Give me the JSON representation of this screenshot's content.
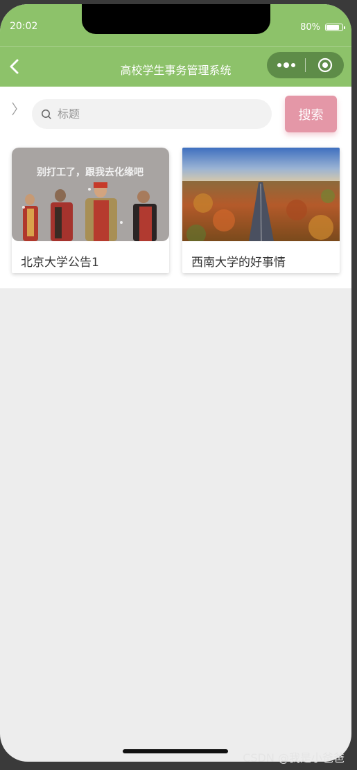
{
  "status_bar": {
    "time": "20:02",
    "battery_percent": "80%",
    "battery_level": 0.8
  },
  "nav": {
    "title": "高校学生事务管理系统"
  },
  "search": {
    "placeholder": "标题",
    "button_label": "搜索"
  },
  "cards": [
    {
      "title": "北京大学公告1",
      "image_caption": "别打工了，跟我去化缘吧"
    },
    {
      "title": "西南大学的好事情"
    }
  ],
  "watermark": "CSDN @我是小爸爸",
  "colors": {
    "theme_green": "#8dc26a",
    "capsule_green": "#5e8c48",
    "search_button_pink": "#e497a7",
    "page_background": "#ededed"
  }
}
